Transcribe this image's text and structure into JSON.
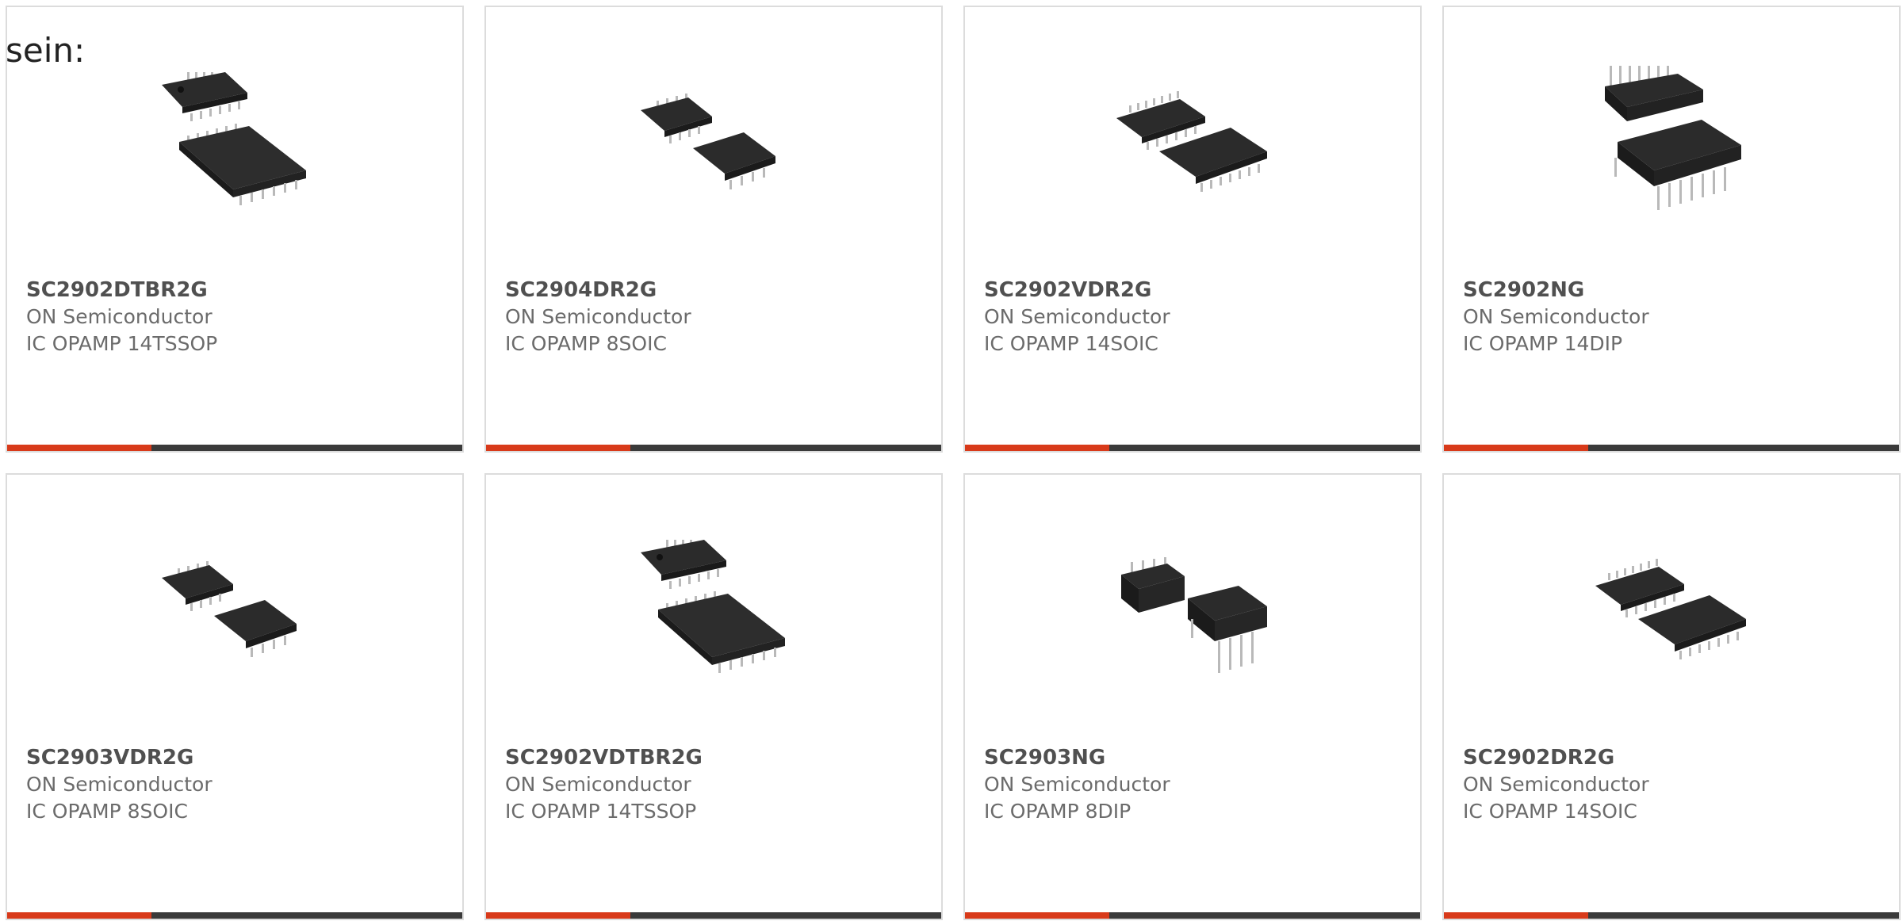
{
  "intro_text": "sein:",
  "colors": {
    "accent": "#d83a1a",
    "bar": "#3a3a3a",
    "chip": "#2b2b2b",
    "pin": "#b9b9b9"
  },
  "products": [
    {
      "part_number": "SC2902DTBR2G",
      "manufacturer": "ON Semiconductor",
      "description": "IC OPAMP 14TSSOP",
      "package_icon": "tssop-chip-icon"
    },
    {
      "part_number": "SC2904DR2G",
      "manufacturer": "ON Semiconductor",
      "description": "IC OPAMP 8SOIC",
      "package_icon": "soic8-chip-icon"
    },
    {
      "part_number": "SC2902VDR2G",
      "manufacturer": "ON Semiconductor",
      "description": "IC OPAMP 14SOIC",
      "package_icon": "soic14-chip-icon"
    },
    {
      "part_number": "SC2902NG",
      "manufacturer": "ON Semiconductor",
      "description": "IC OPAMP 14DIP",
      "package_icon": "dip14-chip-icon"
    },
    {
      "part_number": "SC2903VDR2G",
      "manufacturer": "ON Semiconductor",
      "description": "IC OPAMP 8SOIC",
      "package_icon": "soic8-chip-icon"
    },
    {
      "part_number": "SC2902VDTBR2G",
      "manufacturer": "ON Semiconductor",
      "description": "IC OPAMP 14TSSOP",
      "package_icon": "tssop-chip-icon"
    },
    {
      "part_number": "SC2903NG",
      "manufacturer": "ON Semiconductor",
      "description": "IC OPAMP 8DIP",
      "package_icon": "dip8-chip-icon"
    },
    {
      "part_number": "SC2902DR2G",
      "manufacturer": "ON Semiconductor",
      "description": "IC OPAMP 14SOIC",
      "package_icon": "soic14-chip-icon"
    }
  ]
}
